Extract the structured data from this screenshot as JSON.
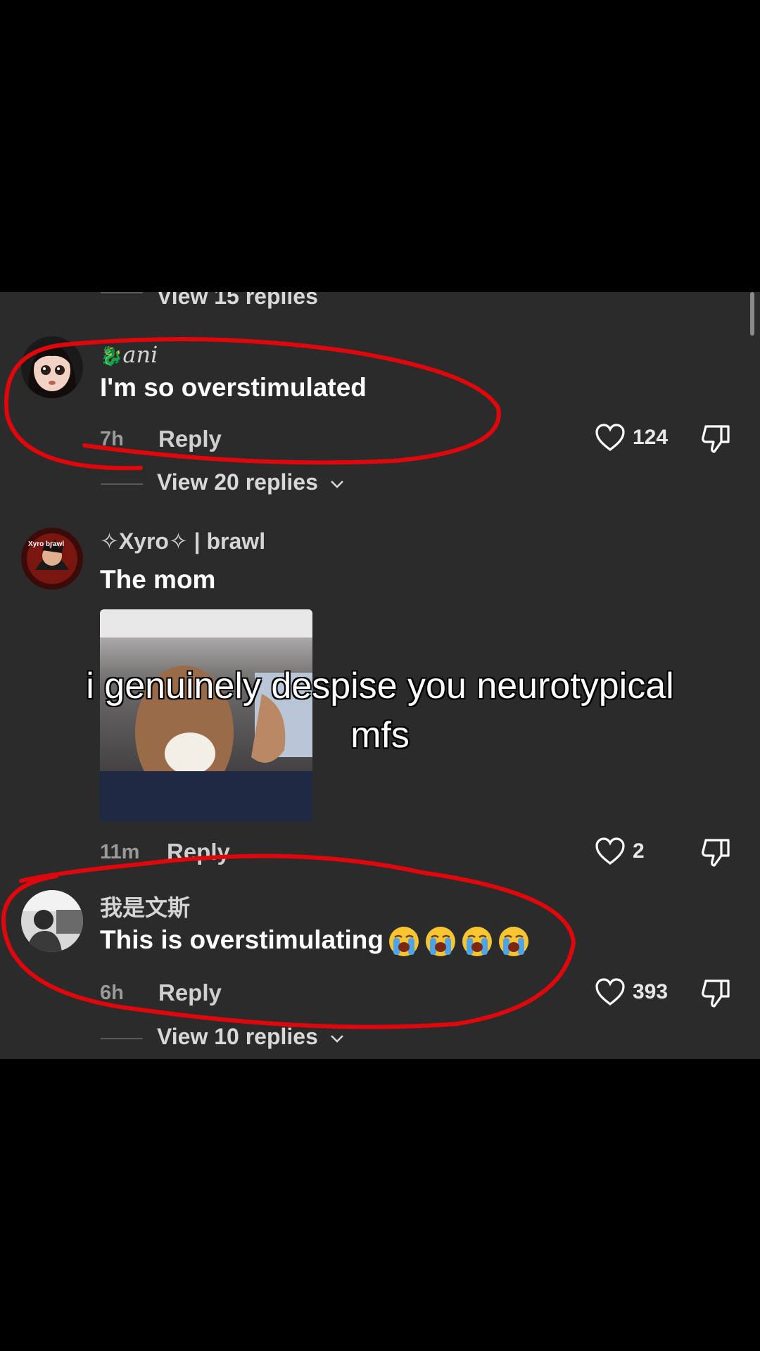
{
  "thread": {
    "top_partial_replies": "View 15 replies",
    "comments": [
      {
        "username": "ani",
        "text": "I'm so overstimulated",
        "time": "7h",
        "reply_label": "Reply",
        "likes": "124",
        "view_replies": "View 20 replies"
      },
      {
        "username": "✧Xyro✧ | brawl",
        "avatar_text": "Xyro brawl",
        "text": "The mom",
        "time": "11m",
        "reply_label": "Reply",
        "likes": "2"
      },
      {
        "username": "我是文斯",
        "text": "This is overstimulating",
        "time": "6h",
        "reply_label": "Reply",
        "likes": "393",
        "view_replies": "View 10 replies"
      }
    ]
  },
  "overlay": {
    "caption_line1": "i genuinely despise you neurotypical",
    "caption_line2": "mfs"
  },
  "colors": {
    "panel_bg": "#2b2b2b",
    "annotation_red": "#e0060b"
  },
  "icons": [
    "heart-icon",
    "dislike-icon",
    "chevron-down-icon",
    "crying-emoji-icon"
  ]
}
